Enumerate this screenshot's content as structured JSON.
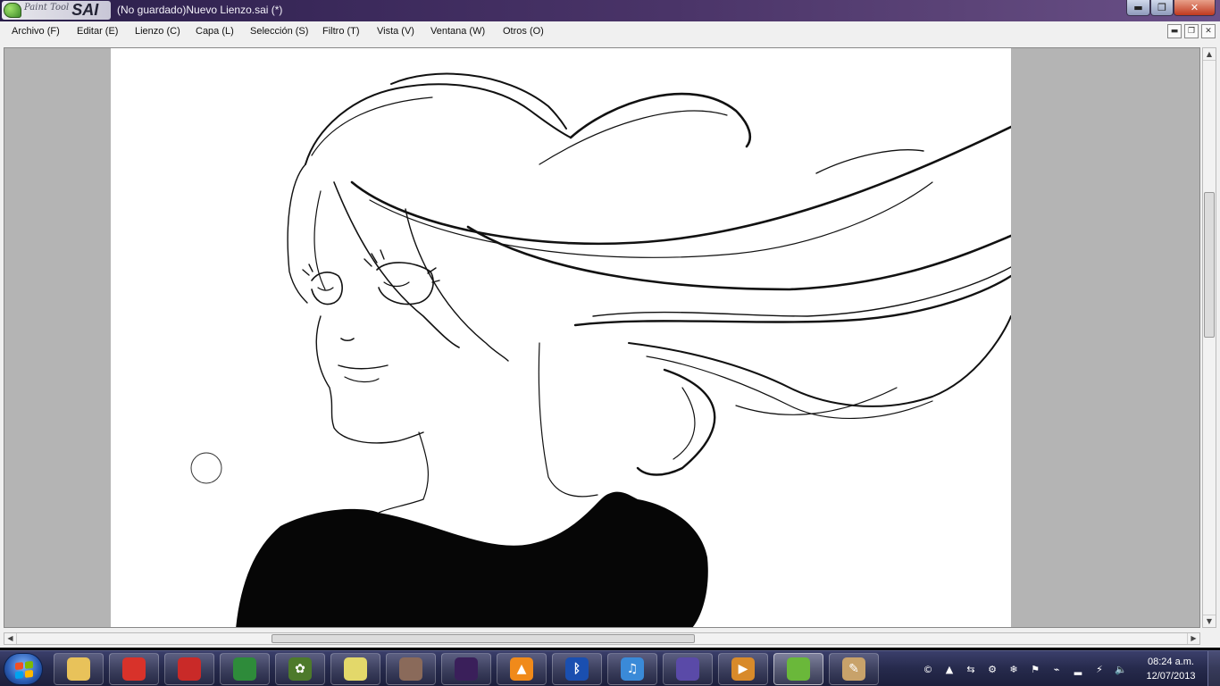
{
  "app": {
    "logo_small": "Paint Tool",
    "logo_big": "SAI",
    "window_title": "(No guardado)Nuevo Lienzo.sai (*)"
  },
  "window_controls": {
    "minimize": "▬",
    "maximize": "❐",
    "close": "✕"
  },
  "menu": {
    "items": [
      "Archivo (F)",
      "Editar (E)",
      "Lienzo (C)",
      "Capa (L)",
      "Selección (S)",
      "Filtro (T)",
      "Vista (V)",
      "Ventana (W)",
      "Otros (O)"
    ],
    "mdi": {
      "minimize": "▬",
      "restore": "❐",
      "close": "✕"
    }
  },
  "scrollbars": {
    "up": "▲",
    "down": "▼",
    "left": "◀",
    "right": "▶",
    "vertical_position": 0.32,
    "horizontal_position": 0.34
  },
  "taskbar": {
    "apps": [
      {
        "icon": "explorer-icon",
        "glyph": "",
        "color": "#e8c25a"
      },
      {
        "icon": "angry-birds-icon",
        "glyph": "",
        "color": "#d8322a"
      },
      {
        "icon": "angry-birds-icon",
        "glyph": "",
        "color": "#c92a28"
      },
      {
        "icon": "chrome-icon",
        "glyph": "",
        "color": "#2e8b3a"
      },
      {
        "icon": "plants-vs-zombies-icon",
        "glyph": "✿",
        "color": "#4d7a2b"
      },
      {
        "icon": "sticky-notes-icon",
        "glyph": "",
        "color": "#e3d86a"
      },
      {
        "icon": "game-icon",
        "glyph": "",
        "color": "#8a6a5a"
      },
      {
        "icon": "angry-birds-space-icon",
        "glyph": "",
        "color": "#3a1f5a"
      },
      {
        "icon": "vlc-icon",
        "glyph": "▲",
        "color": "#f08a1a"
      },
      {
        "icon": "bluetooth-icon",
        "glyph": "ᛒ",
        "color": "#1a4fb0"
      },
      {
        "icon": "itunes-icon",
        "glyph": "♫",
        "color": "#3a8ad8"
      },
      {
        "icon": "bittorrent-icon",
        "glyph": "",
        "color": "#5a4aa8"
      },
      {
        "icon": "media-player-icon",
        "glyph": "▶",
        "color": "#d88a2a"
      },
      {
        "icon": "painttool-sai-icon",
        "glyph": "",
        "color": "#6ab83a"
      },
      {
        "icon": "paint-icon",
        "glyph": "✎",
        "color": "#c8a26a"
      }
    ],
    "tray": [
      {
        "icon": "copyright-icon",
        "glyph": "©"
      },
      {
        "icon": "vlc-tray-icon",
        "glyph": "▲"
      },
      {
        "icon": "network-tray-icon",
        "glyph": "⇆"
      },
      {
        "icon": "security-tray-icon",
        "glyph": "⚙"
      },
      {
        "icon": "snowflake-icon",
        "glyph": "❄"
      },
      {
        "icon": "flag-icon",
        "glyph": "⚑"
      },
      {
        "icon": "usb-icon",
        "glyph": "⌁"
      },
      {
        "icon": "signal-icon",
        "glyph": "▂"
      },
      {
        "icon": "power-icon",
        "glyph": "⚡"
      },
      {
        "icon": "volume-icon",
        "glyph": "🔈"
      }
    ],
    "clock_time": "08:24 a.m.",
    "clock_date": "12/07/2013"
  }
}
